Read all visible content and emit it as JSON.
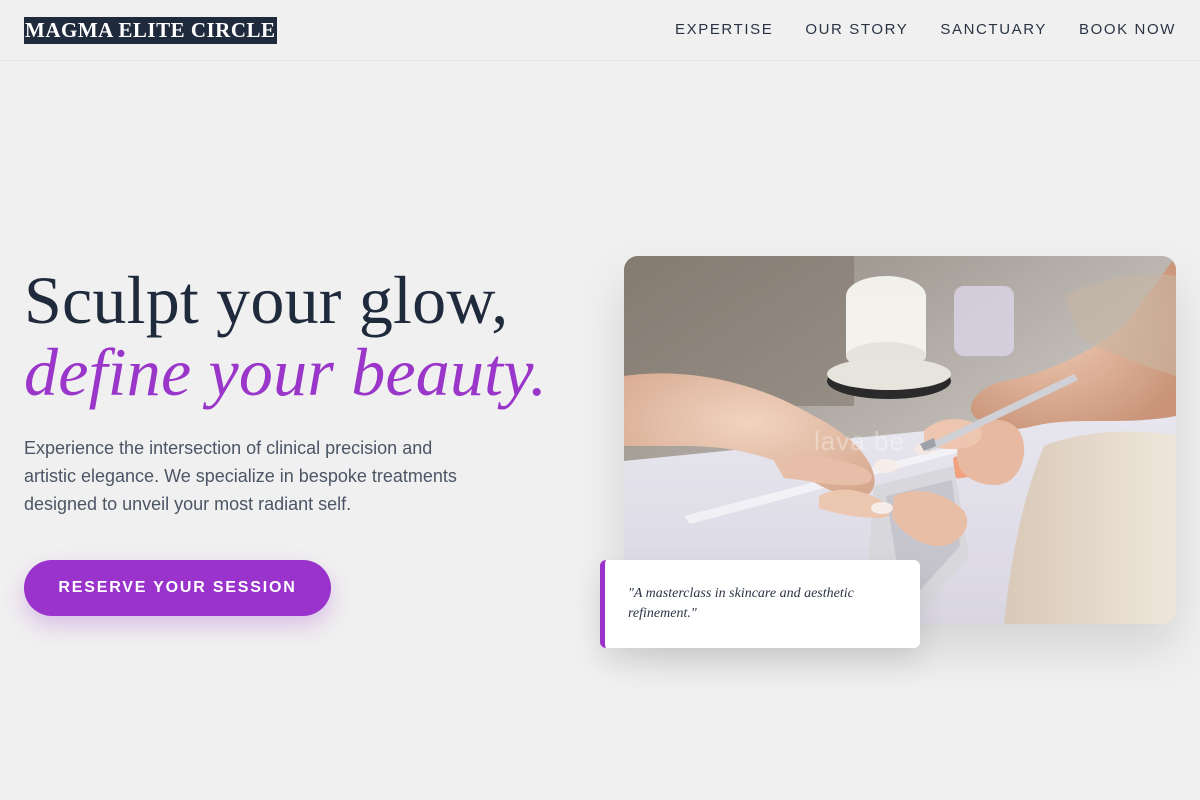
{
  "header": {
    "brand": "MAGMA ELITE CIRCLE",
    "nav": [
      {
        "label": "EXPERTISE"
      },
      {
        "label": "OUR STORY"
      },
      {
        "label": "SANCTUARY"
      },
      {
        "label": "BOOK NOW"
      }
    ]
  },
  "hero": {
    "title_line1": "Sculpt your glow,",
    "title_line2": "define your beauty.",
    "subtitle": "Experience the intersection of clinical precision and artistic elegance. We specialize in bespoke treatments designed to unveil your most radiant self.",
    "cta_label": "RESERVE YOUR SESSION",
    "image_watermark": "lava be",
    "quote": "\"A masterclass in skincare and aesthetic refinement.\""
  },
  "colors": {
    "background": "#f0f0f0",
    "navy": "#1f2a3c",
    "accent_purple": "#9a32cc",
    "body_text": "#4b5565"
  }
}
